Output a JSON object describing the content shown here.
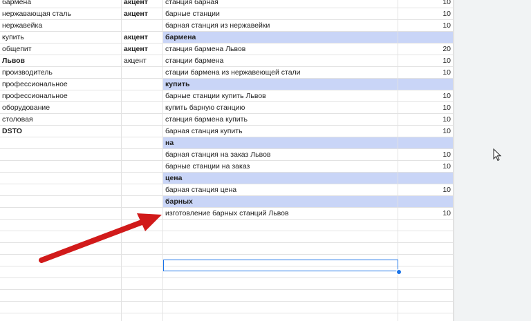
{
  "rows": [
    {
      "c1": "бармена",
      "c1_bold": false,
      "c2": "акцент",
      "c2_bold": true,
      "c3": "станция барная",
      "c4": "10",
      "group": false
    },
    {
      "c1": "нержавающая сталь",
      "c1_bold": false,
      "c2": "акцент",
      "c2_bold": true,
      "c3": "барные станции",
      "c4": "10",
      "group": false
    },
    {
      "c1": "нержавейка",
      "c1_bold": false,
      "c2": "",
      "c2_bold": false,
      "c3": "барная станция из нержавейки",
      "c4": "10",
      "group": false
    },
    {
      "c1": "купить",
      "c1_bold": false,
      "c2": "акцент",
      "c2_bold": true,
      "c3": "бармена",
      "c4": "",
      "group": true
    },
    {
      "c1": "общепит",
      "c1_bold": false,
      "c2": "акцент",
      "c2_bold": true,
      "c3": "станция бармена Львов",
      "c4": "20",
      "group": false
    },
    {
      "c1": "Львов",
      "c1_bold": true,
      "c2": "акцент",
      "c2_bold": false,
      "c3": "станции бармена",
      "c4": "10",
      "group": false
    },
    {
      "c1": "производитель",
      "c1_bold": false,
      "c2": "",
      "c2_bold": false,
      "c3": "стации бармена из нержавеющей стали",
      "c4": "10",
      "group": false
    },
    {
      "c1": "профессиональное",
      "c1_bold": false,
      "c2": "",
      "c2_bold": false,
      "c3": "купить",
      "c4": "",
      "group": true
    },
    {
      "c1": "профессиональное",
      "c1_bold": false,
      "c2": "",
      "c2_bold": false,
      "c3": "барные станции купить Львов",
      "c4": "10",
      "group": false
    },
    {
      "c1": "оборудование",
      "c1_bold": false,
      "c2": "",
      "c2_bold": false,
      "c3": "купить барную станцию",
      "c4": "10",
      "group": false
    },
    {
      "c1": "столовая",
      "c1_bold": false,
      "c2": "",
      "c2_bold": false,
      "c3": "станция бармена купить",
      "c4": "10",
      "group": false
    },
    {
      "c1": "DSTO",
      "c1_bold": true,
      "c2": "",
      "c2_bold": false,
      "c3": "барная станция купить",
      "c4": "10",
      "group": false
    },
    {
      "c1": "",
      "c1_bold": false,
      "c2": "",
      "c2_bold": false,
      "c3": "на",
      "c4": "",
      "group": true
    },
    {
      "c1": "",
      "c1_bold": false,
      "c2": "",
      "c2_bold": false,
      "c3": "барная станция на заказ Львов",
      "c4": "10",
      "group": false
    },
    {
      "c1": "",
      "c1_bold": false,
      "c2": "",
      "c2_bold": false,
      "c3": "барные станции на заказ",
      "c4": "10",
      "group": false
    },
    {
      "c1": "",
      "c1_bold": false,
      "c2": "",
      "c2_bold": false,
      "c3": "цена",
      "c4": "",
      "group": true
    },
    {
      "c1": "",
      "c1_bold": false,
      "c2": "",
      "c2_bold": false,
      "c3": "барная станция цена",
      "c4": "10",
      "group": false
    },
    {
      "c1": "",
      "c1_bold": false,
      "c2": "",
      "c2_bold": false,
      "c3": "барных",
      "c4": "",
      "group": true
    },
    {
      "c1": "",
      "c1_bold": false,
      "c2": "",
      "c2_bold": false,
      "c3": "изготовление барных станций Львов",
      "c4": "10",
      "group": false
    },
    {
      "c1": "",
      "c1_bold": false,
      "c2": "",
      "c2_bold": false,
      "c3": "",
      "c4": "",
      "group": false
    },
    {
      "c1": "",
      "c1_bold": false,
      "c2": "",
      "c2_bold": false,
      "c3": "",
      "c4": "",
      "group": false
    },
    {
      "c1": "",
      "c1_bold": false,
      "c2": "",
      "c2_bold": false,
      "c3": "",
      "c4": "",
      "group": false
    },
    {
      "c1": "",
      "c1_bold": false,
      "c2": "",
      "c2_bold": false,
      "c3": "",
      "c4": "",
      "group": false
    },
    {
      "c1": "",
      "c1_bold": false,
      "c2": "",
      "c2_bold": false,
      "c3": "",
      "c4": "",
      "group": false
    },
    {
      "c1": "",
      "c1_bold": false,
      "c2": "",
      "c2_bold": false,
      "c3": "",
      "c4": "",
      "group": false
    },
    {
      "c1": "",
      "c1_bold": false,
      "c2": "",
      "c2_bold": false,
      "c3": "",
      "c4": "",
      "group": false
    },
    {
      "c1": "",
      "c1_bold": false,
      "c2": "",
      "c2_bold": false,
      "c3": "",
      "c4": "",
      "group": false
    },
    {
      "c1": "",
      "c1_bold": false,
      "c2": "",
      "c2_bold": false,
      "c3": "",
      "c4": "",
      "group": false
    }
  ],
  "colors": {
    "group_fill": "#c9d5f7",
    "selection": "#1a73e8",
    "annotation_arrow": "#d11a1a",
    "gridline": "#e2e2e2",
    "outside_area": "#f1f3f4"
  },
  "icons": {
    "cursor": "mouse-pointer-icon",
    "annotation": "red-arrow-annotation"
  }
}
